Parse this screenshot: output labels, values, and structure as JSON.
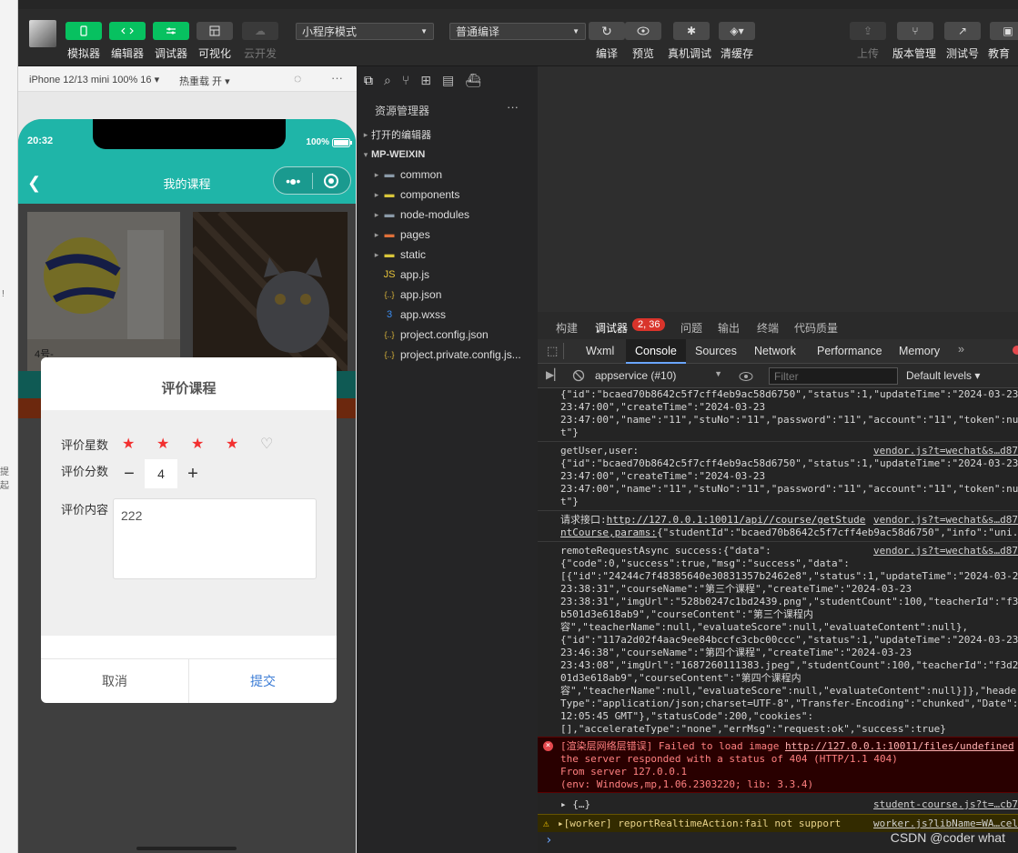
{
  "toolbar": {
    "buttons": [
      {
        "label": "模拟器",
        "icon": "phone-icon"
      },
      {
        "label": "编辑器",
        "icon": "code-icon"
      },
      {
        "label": "调试器",
        "icon": "debug-icon"
      },
      {
        "label": "可视化",
        "icon": "layout-icon"
      },
      {
        "label": "云开发",
        "icon": "cloud-icon"
      }
    ],
    "mode_select": "小程序模式",
    "compile_select": "普通编译",
    "actions": [
      {
        "label": "编译",
        "icon": "refresh-icon"
      },
      {
        "label": "预览",
        "icon": "eye-icon"
      },
      {
        "label": "真机调试",
        "icon": "bug-icon"
      },
      {
        "label": "清缓存",
        "icon": "layers-icon"
      }
    ],
    "right_actions": [
      {
        "label": "上传",
        "icon": "upload-icon"
      },
      {
        "label": "版本管理",
        "icon": "branch-icon"
      },
      {
        "label": "测试号",
        "icon": "external-icon"
      },
      {
        "label": "教育",
        "icon": "edu-icon"
      }
    ]
  },
  "left_strip": {
    "text1": "!",
    "text2": "提起"
  },
  "simulator": {
    "device": "iPhone 12/13 mini 100% 16 ▾",
    "hot_reload": "热重载 开 ▾",
    "time": "20:32",
    "battery": "100%",
    "nav_title": "我的课程"
  },
  "modal": {
    "title": "评价课程",
    "rating_label": "评价星数",
    "score_label": "评价分数",
    "score_value": "4",
    "content_label": "评价内容",
    "content_value": "222",
    "cancel": "取消",
    "submit": "提交",
    "stars_filled": 4,
    "stars_total": 5
  },
  "explorer": {
    "title": "资源管理器",
    "more": "···",
    "open_editors": "打开的编辑器",
    "project": "MP-WEIXIN",
    "items": [
      {
        "name": "common",
        "type": "folder"
      },
      {
        "name": "components",
        "type": "folder"
      },
      {
        "name": "node-modules",
        "type": "folder"
      },
      {
        "name": "pages",
        "type": "folder"
      },
      {
        "name": "static",
        "type": "folder"
      },
      {
        "name": "app.js",
        "type": "js"
      },
      {
        "name": "app.json",
        "type": "json"
      },
      {
        "name": "app.wxss",
        "type": "wxss"
      },
      {
        "name": "project.config.json",
        "type": "json"
      },
      {
        "name": "project.private.config.js...",
        "type": "json"
      }
    ]
  },
  "debug_tabs": {
    "items": [
      "构建",
      "调试器",
      "问题",
      "输出",
      "终端",
      "代码质量"
    ],
    "badge": "2, 36"
  },
  "devtools_tabs": [
    "Wxml",
    "Console",
    "Sources",
    "Network",
    "Performance",
    "Memory",
    "»"
  ],
  "console_toolbar": {
    "context": "appservice (#10)",
    "filter_placeholder": "Filter",
    "levels": "Default levels ▾"
  },
  "console": {
    "lines1": [
      "{\"id\":\"bcaed70b8642c5f7cff4eb9ac58d6750\",\"status\":1,\"updateTime\":\"2024-03-23",
      "23:47:00\",\"createTime\":\"2024-03-23",
      "23:47:00\",\"name\":\"11\",\"stuNo\":\"11\",\"password\":\"11\",\"account\":\"11\",\"token\":nul",
      "t\"}"
    ],
    "getuser_head": "getUser,user:",
    "getuser_src": "vendor.js?t=wechat&s…d87",
    "lines2": [
      "{\"id\":\"bcaed70b8642c5f7cff4eb9ac58d6750\",\"status\":1,\"updateTime\":\"2024-03-23",
      "23:47:00\",\"createTime\":\"2024-03-23",
      "23:47:00\",\"name\":\"11\",\"stuNo\":\"11\",\"password\":\"11\",\"account\":\"11\",\"token\":nul",
      "t\"}"
    ],
    "request_prefix": "请求接口:",
    "request_url1": "http://127.0.0.1:10011/api//course/getStude",
    "request_url2": "ntCourse,params:",
    "request_rest1": "{\"studentId\":\"bcaed70b8642c5f7cff4eb9ac58d6750\",\"info\":\"uni.",
    "request_src": "vendor.js?t=wechat&s…d87",
    "remote_head": "remoteRequestAsync success:{\"data\":",
    "remote_src": "vendor.js?t=wechat&s…d87",
    "lines3": [
      "{\"code\":0,\"success\":true,\"msg\":\"success\",\"data\":",
      "[{\"id\":\"24244c7f48385640e30831357b2462e8\",\"status\":1,\"updateTime\":\"2024-03-23",
      "23:38:31\",\"courseName\":\"第三个课程\",\"createTime\":\"2024-03-23",
      "23:38:31\",\"imgUrl\":\"528b0247c1bd2439.png\",\"studentCount\":100,\"teacherId\":\"f3d",
      "b501d3e618ab9\",\"courseContent\":\"第三个课程内",
      "容\",\"teacherName\":null,\"evaluateScore\":null,\"evaluateContent\":null},",
      "{\"id\":\"117a2d02f4aac9ee84bccfc3cbc00ccc\",\"status\":1,\"updateTime\":\"2024-03-23",
      "23:46:38\",\"courseName\":\"第四个课程\",\"createTime\":\"2024-03-23",
      "23:43:08\",\"imgUrl\":\"1687260111383.jpeg\",\"studentCount\":100,\"teacherId\":\"f3d2",
      "01d3e618ab9\",\"courseContent\":\"第四个课程内",
      "容\",\"teacherName\":null,\"evaluateScore\":null,\"evaluateContent\":null}]},\"header",
      "Type\":\"application/json;charset=UTF-8\",\"Transfer-Encoding\":\"chunked\",\"Date\":",
      "12:05:45 GMT\"},\"statusCode\":200,\"cookies\":",
      "[],\"accelerateType\":\"none\",\"errMsg\":\"request:ok\",\"success\":true}"
    ],
    "error_head": "[渲染层网络层错误] Failed to load image ",
    "error_url": "http://127.0.0.1:10011/files/undefined",
    "error_lines": [
      "the server responded with a status of 404 (HTTP/1.1 404)",
      "From server 127.0.0.1",
      "(env: Windows,mp,1.06.2303220; lib: 3.3.4)"
    ],
    "obj_line": "▸ {…}",
    "obj_src": "student-course.js?t=…cb7",
    "warn_line": "▸[worker] reportRealtimeAction:fail not support",
    "warn_src": "worker.js?libName=WA…cel",
    "prompt": "›"
  },
  "watermark": "CSDN @coder what",
  "colors": {
    "accent": "#07c160",
    "teal": "#1fb5a8",
    "star": "#f23030",
    "submit": "#3a7bd5",
    "error_bg": "#290000"
  }
}
